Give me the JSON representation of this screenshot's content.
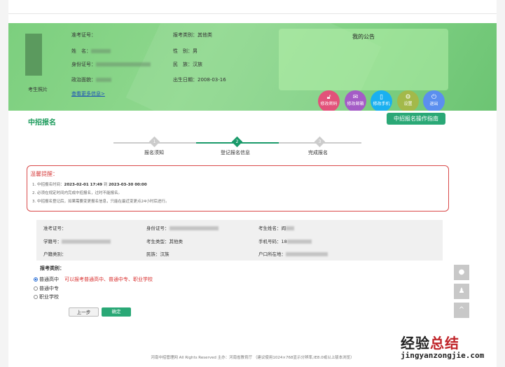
{
  "profile": {
    "photo_label": "考生照片",
    "exam_no_label": "准考证号：",
    "name_label": "姓　名：",
    "id_label": "身份证号：",
    "politics_label": "政治面貌：",
    "more_link": "查看更多信息>",
    "category_label": "报考类别：",
    "category_value": "其他类",
    "gender_label": "性　别：",
    "gender_value": "男",
    "ethnic_label": "民　族：",
    "ethnic_value": "汉族",
    "birth_label": "出生日期：",
    "birth_value": "2008-03-16"
  },
  "notice": {
    "title": "我的公告"
  },
  "actions": [
    {
      "label": "修改密码",
      "icon": "lock-icon",
      "color": "#e2527a"
    },
    {
      "label": "修改邮箱",
      "icon": "mail-icon",
      "color": "#a45cc6"
    },
    {
      "label": "修改手机",
      "icon": "phone-icon",
      "color": "#1ab0f0"
    },
    {
      "label": "设置",
      "icon": "gear-icon",
      "color": "#a3b94a"
    },
    {
      "label": "退出",
      "icon": "power-icon",
      "color": "#5b8fef"
    }
  ],
  "guide_button": "中招报名操作指南",
  "page_title": "中招报名",
  "steps": [
    {
      "num": "1",
      "label": "报名须知"
    },
    {
      "num": "2",
      "label": "登记报名信息"
    },
    {
      "num": "3",
      "label": "完成报名"
    }
  ],
  "alert": {
    "title": "温馨提醒：",
    "line1_prefix": "1. 中招报名时间：",
    "start": "2023-02-01 17:49",
    "to": " 到 ",
    "end": "2023-03-30 00:00",
    "line2": "2. 必须在规定时间内完成中招报名，过时不能报名。",
    "line3": "3. 中招报名登记后，如果需要变更报名信息，只能在最近变更点24小时后进行。"
  },
  "details": {
    "exam_no": "准考证号：",
    "id": "身份证号：",
    "name": "考生姓名：",
    "name_value": "阎",
    "student_no": "学籍号：",
    "type": "考生类型：其他类",
    "phone": "手机号码：",
    "phone_value": "18",
    "household": "户籍类别：",
    "ethnic": "民族：汉族",
    "address": "户口所在地："
  },
  "form": {
    "heading": "报考类别：",
    "options": [
      "普通高中",
      "普通中专",
      "职业学校"
    ],
    "selected": 0,
    "tip": "可以报考普通高中、普通中专、职业学校",
    "prev": "上一步",
    "confirm": "确定"
  },
  "footer": "河南中招管理网 All Rights Reserved 主办：河南省教育厅 （建议使用1024×768显示分辨率,IE8.0或以上版本浏览）",
  "watermark": {
    "cn": "经验总结",
    "url": "jingyanzongjie.com"
  }
}
